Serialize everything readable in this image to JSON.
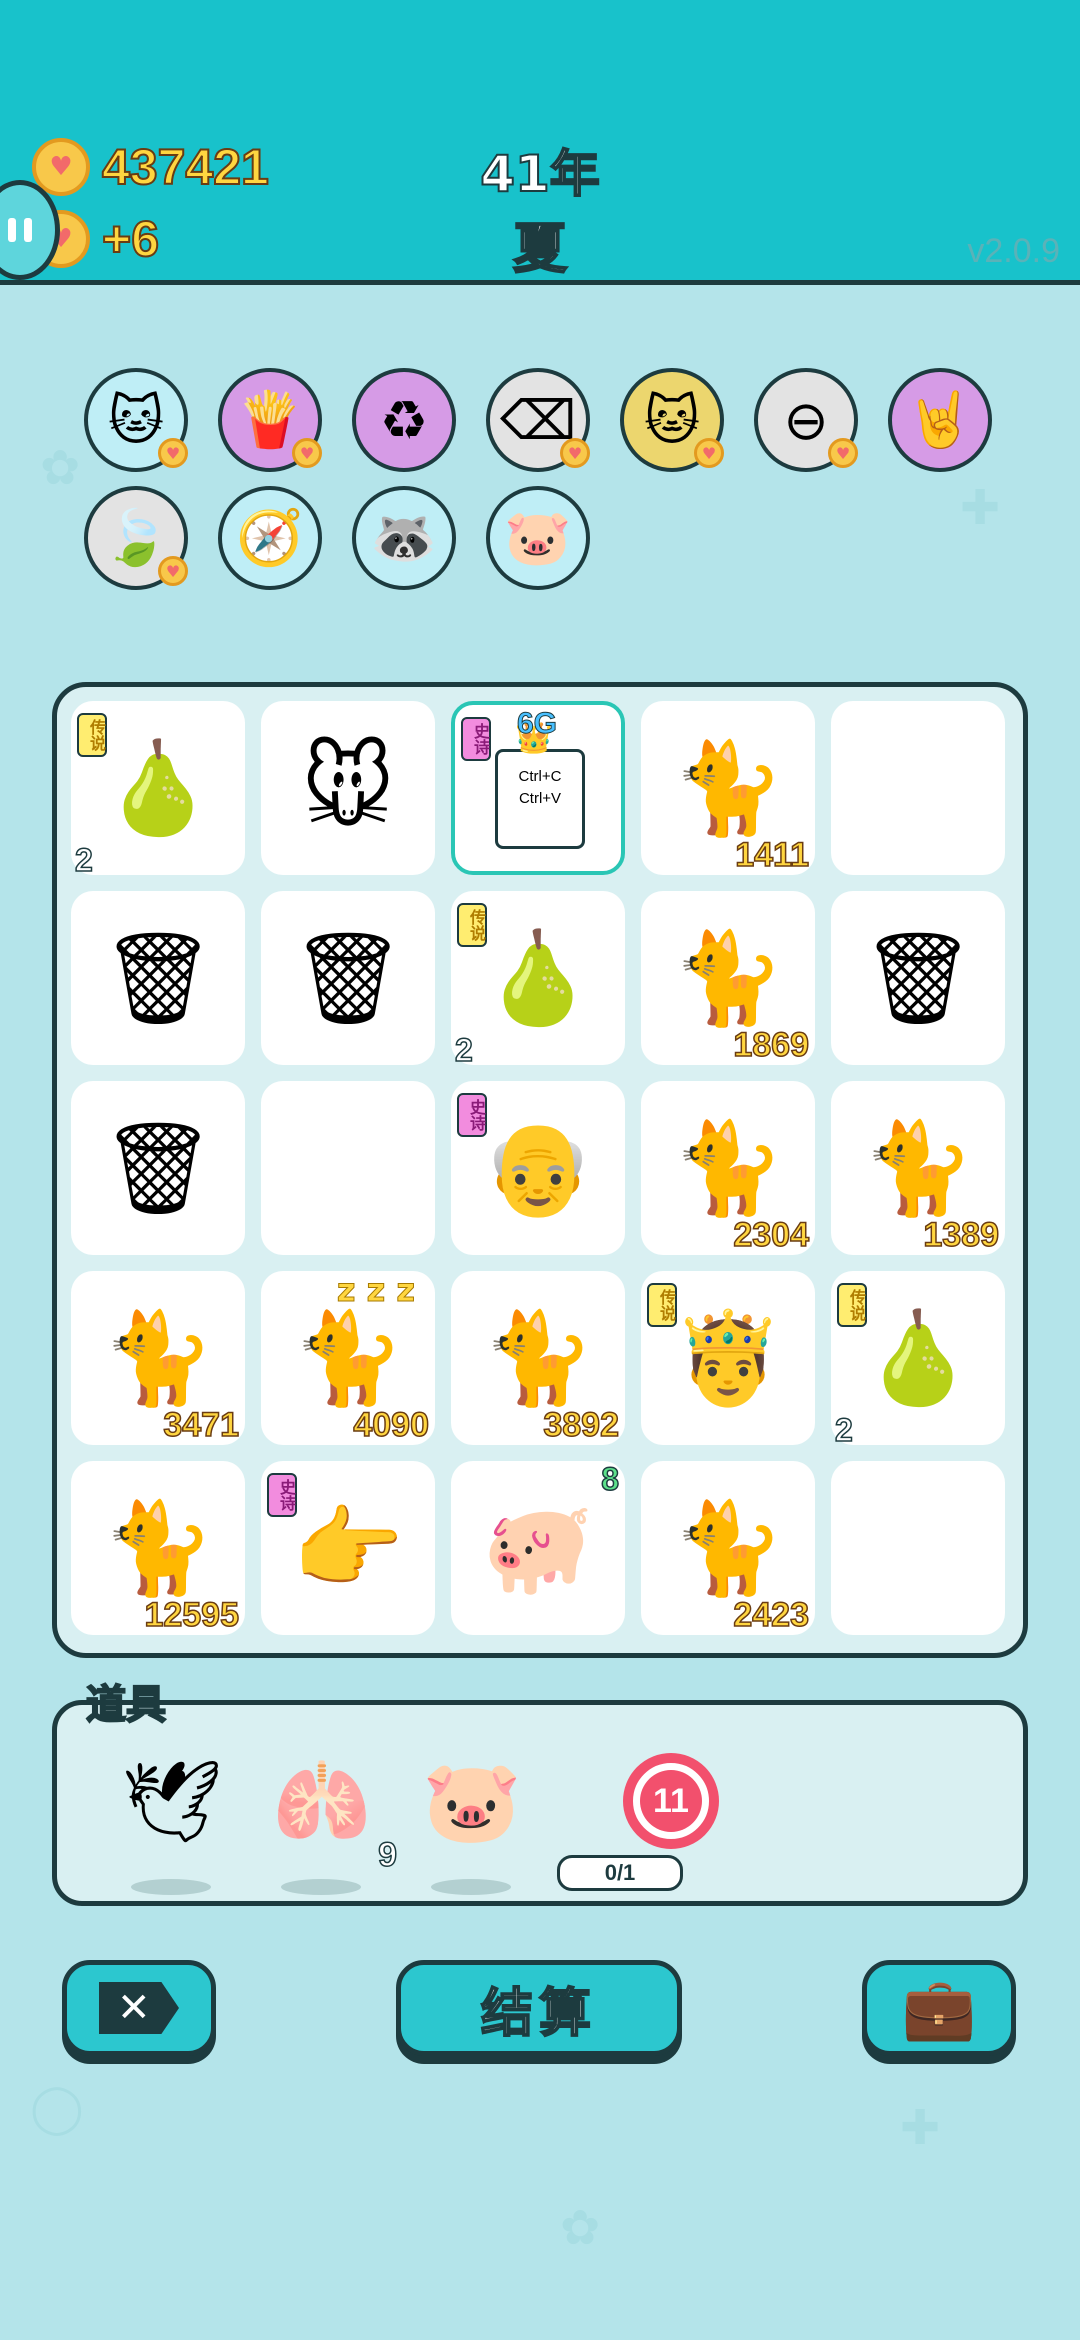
{
  "header": {
    "coins": "437421",
    "income": "+6",
    "year": "41年",
    "season": "夏",
    "version": "v2.0.9"
  },
  "skills": [
    {
      "name": "cat-coin-skill",
      "glyph": "🐱",
      "bg": "#bfeef6",
      "heart": true
    },
    {
      "name": "fries-skill",
      "glyph": "🍟",
      "bg": "#d69be6",
      "heart": true
    },
    {
      "name": "recycle-skill",
      "glyph": "♻",
      "bg": "#d69be6",
      "heart": false
    },
    {
      "name": "delete-skill",
      "glyph": "⌫",
      "bg": "#e3e3e3",
      "heart": true
    },
    {
      "name": "double-cat-skill",
      "glyph": "🐱",
      "bg": "#ecd66e",
      "heart": true
    },
    {
      "name": "minus-skill",
      "glyph": "⊖",
      "bg": "#e3e3e3",
      "heart": true
    },
    {
      "name": "rock-hand-skill",
      "glyph": "🤘",
      "bg": "#d69be6",
      "heart": false
    },
    {
      "name": "leaf-skill",
      "glyph": "🍃",
      "bg": "#e3e3e3",
      "heart": true
    },
    {
      "name": "compass-skill",
      "glyph": "🧭",
      "bg": "#bfeef6",
      "heart": false
    },
    {
      "name": "raccoon-skill",
      "glyph": "🦝",
      "bg": "#bfeef6",
      "heart": false
    },
    {
      "name": "piggy-skill",
      "glyph": "🐷",
      "bg": "#bfeef6",
      "heart": false
    }
  ],
  "board": [
    [
      {
        "item": "pear",
        "glyph": "🍐",
        "tag": "传说",
        "tagType": "legend",
        "count": "2"
      },
      {
        "item": "mouse",
        "glyph": "🐭"
      },
      {
        "item": "ctrl-cv-king",
        "selected": true,
        "tag": "史诗",
        "tagType": "epic",
        "badge": "6G",
        "ctrl": "Ctrl+C\nCtrl+V"
      },
      {
        "item": "cat",
        "glyph": "🐈",
        "value": "1411"
      },
      {
        "item": "empty"
      }
    ],
    [
      {
        "item": "trash-bag",
        "glyph": "🗑"
      },
      {
        "item": "trash-bag",
        "glyph": "🗑"
      },
      {
        "item": "pear",
        "glyph": "🍐",
        "tag": "传说",
        "tagType": "legend",
        "count": "2"
      },
      {
        "item": "cat",
        "glyph": "🐈",
        "value": "1869"
      },
      {
        "item": "trash-bag",
        "glyph": "🗑"
      }
    ],
    [
      {
        "item": "trash-bag",
        "glyph": "🗑"
      },
      {
        "item": "empty"
      },
      {
        "item": "old-man",
        "glyph": "👴",
        "tag": "史诗",
        "tagType": "epic"
      },
      {
        "item": "cat",
        "glyph": "🐈",
        "value": "2304"
      },
      {
        "item": "cat",
        "glyph": "🐈",
        "value": "1389"
      }
    ],
    [
      {
        "item": "cat",
        "glyph": "🐈",
        "value": "3471"
      },
      {
        "item": "sleeping-cat",
        "glyph": "🐈",
        "value": "4090",
        "zzz": "z z z"
      },
      {
        "item": "cat",
        "glyph": "🐈",
        "value": "3892"
      },
      {
        "item": "king-face",
        "glyph": "🤴",
        "tag": "传说",
        "tagType": "legend"
      },
      {
        "item": "king-pear",
        "glyph": "🍐",
        "tag": "传说",
        "tagType": "legend",
        "count": "2"
      }
    ],
    [
      {
        "item": "cat",
        "glyph": "🐈",
        "value": "12595"
      },
      {
        "item": "pointing-hand",
        "glyph": "👉",
        "tag": "史诗",
        "tagType": "epic"
      },
      {
        "item": "pig",
        "glyph": "🐖",
        "countGreen": "8"
      },
      {
        "item": "cat",
        "glyph": "🐈",
        "value": "2423"
      },
      {
        "item": "empty"
      }
    ]
  ],
  "tools": {
    "title": "道具",
    "items": [
      {
        "name": "bird-tool",
        "glyph": "🕊"
      },
      {
        "name": "liver-tool",
        "glyph": "🫁",
        "count": "9"
      },
      {
        "name": "piggy-bank-tool",
        "glyph": "🐷"
      }
    ],
    "timer": "11",
    "limit": "0/1"
  },
  "buttons": {
    "settle": "结算"
  }
}
